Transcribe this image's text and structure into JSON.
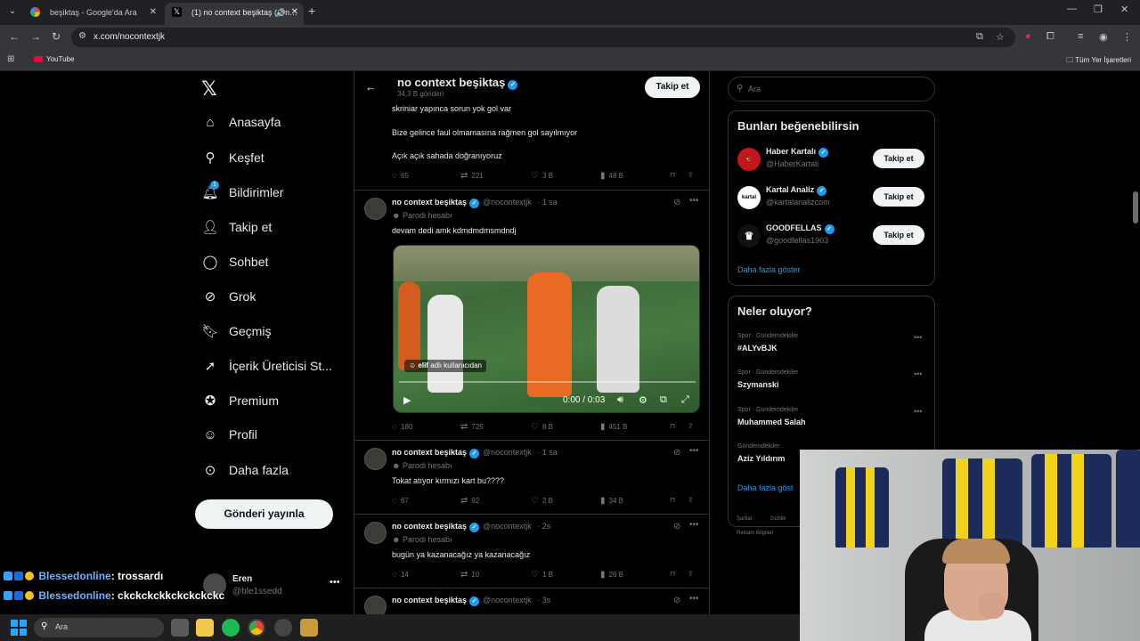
{
  "browser": {
    "tabs": [
      {
        "title": "beşiktaş - Google'da Ara",
        "active": false
      },
      {
        "title": "(1) no context beşiktaş (@n…",
        "active": true
      }
    ],
    "url": "x.com/nocontextjk",
    "bookmarks": [
      {
        "label": "YouTube"
      }
    ],
    "all_bookmarks_label": "Tüm Yer İşaretleri"
  },
  "nav": {
    "items": [
      {
        "label": "Anasayfa",
        "icon": "home-icon"
      },
      {
        "label": "Keşfet",
        "icon": "search-icon"
      },
      {
        "label": "Bildirimler",
        "icon": "bell-icon",
        "badge": "1"
      },
      {
        "label": "Takip et",
        "icon": "person-add-icon"
      },
      {
        "label": "Sohbet",
        "icon": "chat-icon"
      },
      {
        "label": "Grok",
        "icon": "grok-icon"
      },
      {
        "label": "Geçmiş",
        "icon": "bookmark-icon"
      },
      {
        "label": "İçerik Üreticisi St...",
        "icon": "rocket-icon"
      },
      {
        "label": "Premium",
        "icon": "verified-icon"
      },
      {
        "label": "Profil",
        "icon": "profile-icon"
      },
      {
        "label": "Daha fazla",
        "icon": "more-circle-icon"
      }
    ],
    "post_button": "Gönderi yayınla",
    "account": {
      "name": "Eren",
      "handle": "@ble1ssedd"
    }
  },
  "profile_header": {
    "name": "no context beşiktaş",
    "post_count": "34,3 B gönderi",
    "follow_label": "Takip et"
  },
  "prev_tweet": {
    "lines": [
      "skriniar yapınca sorun yok gol var",
      "Bize gelince faul olmamasına rağmen gol sayılmıyor",
      "Açık açık sahada doğranıyoruz"
    ],
    "replies": "65",
    "reposts": "221",
    "likes": "3 B",
    "views": "48 B"
  },
  "tweets": [
    {
      "name": "no context beşiktaş",
      "handle": "@nocontextjk",
      "time": "· 1 sa",
      "parody": "Parodi hesabı",
      "text": "devam dedi amk kdmdmdmsmdndj",
      "video": {
        "label_user": "elif",
        "label_rest": "adlı kullanıcıdan",
        "time": "0:00 / 0:03"
      },
      "replies": "180",
      "reposts": "725",
      "likes": "8 B",
      "views": "451 B"
    },
    {
      "name": "no context beşiktaş",
      "handle": "@nocontextjk",
      "time": "· 1 sa",
      "parody": "Parodi hesabı",
      "text": "Tokat atıyor kırmızı kart bu????",
      "replies": "67",
      "reposts": "92",
      "likes": "2 B",
      "views": "34 B"
    },
    {
      "name": "no context beşiktaş",
      "handle": "@nocontextjk",
      "time": "· 2s",
      "parody": "Parodi hesabı",
      "text": "bugün ya kazanacağız ya kazanacağız",
      "replies": "14",
      "reposts": "10",
      "likes": "1 B",
      "views": "26 B"
    },
    {
      "name": "no context beşiktaş",
      "handle": "@nocontextjk",
      "time": "· 3s"
    }
  ],
  "right": {
    "search_placeholder": "Ara",
    "suggestions_title": "Bunları beğenebilirsin",
    "suggestions": [
      {
        "name": "Haber Kartalı",
        "handle": "@HaberKartali",
        "button": "Takip et"
      },
      {
        "name": "Kartal Analiz",
        "handle": "@kartalanalizcom",
        "button": "Takip et"
      },
      {
        "name": "GOODFELLAS",
        "handle": "@goodfellas1903",
        "button": "Takip et"
      }
    ],
    "show_more": "Daha fazla göster",
    "trends_title": "Neler oluyor?",
    "trends": [
      {
        "category": "Spor · Gündemdekiler",
        "name": "#ALYvBJK"
      },
      {
        "category": "Spor · Gündemdekiler",
        "name": "Szymanski"
      },
      {
        "category": "Spor · Gündemdekiler",
        "name": "Muhammed Salah"
      },
      {
        "category": "Gündemdekiler",
        "name": "Aziz Yıldırım"
      }
    ],
    "trends_more": "Daha fazla göst",
    "footer": [
      "Şartlar",
      "Gizlilik",
      "Reklam Bilgileri"
    ]
  },
  "chat": [
    {
      "user": "Blessedonline",
      "message": ": trossardı"
    },
    {
      "user": "Blessedonline",
      "message": ": ckckckckkckckckckc"
    }
  ],
  "taskbar": {
    "search_placeholder": "Ara"
  },
  "colors": {
    "accent": "#1d9bf0",
    "background": "#000000",
    "border": "#2f3336",
    "muted": "#71767b"
  }
}
